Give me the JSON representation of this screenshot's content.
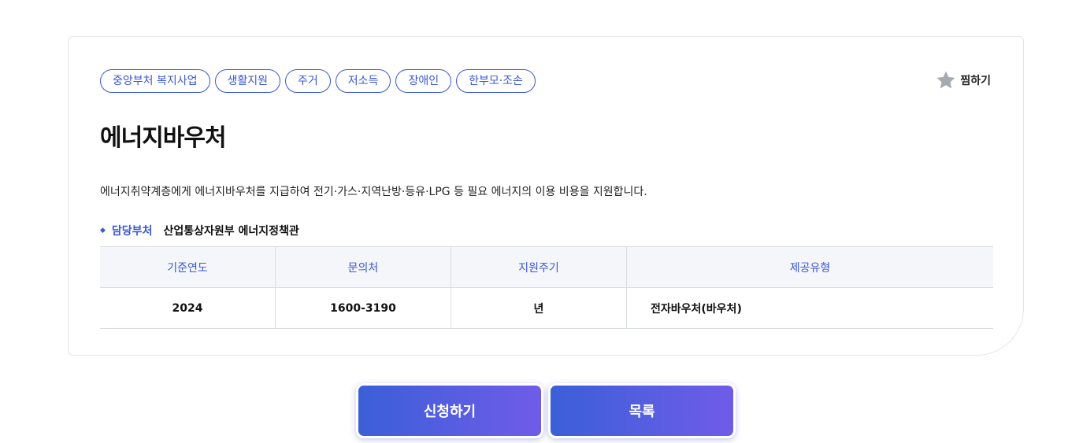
{
  "tags": [
    "중앙부처 복지사업",
    "생활지원",
    "주거",
    "저소득",
    "장애인",
    "한부모·조손"
  ],
  "favorite": {
    "label": "찜하기",
    "icon": "star-icon"
  },
  "title": "에너지바우처",
  "description": "에너지취약계층에게 에너지바우처를 지급하여 전기·가스·지역난방·등유·LPG 등 필요 에너지의 이용 비용을 지원합니다.",
  "department": {
    "label": "담당부처",
    "value": "산업통상자원부 에너지정책관"
  },
  "table": {
    "headers": [
      "기준연도",
      "문의처",
      "지원주기",
      "제공유형"
    ],
    "row": [
      "2024",
      "1600-3190",
      "년",
      "전자바우처(바우처)"
    ]
  },
  "buttons": {
    "apply": "신청하기",
    "list": "목록"
  },
  "colors": {
    "accent": "#3b57d4",
    "button_gradient_start": "#3b5fd8",
    "button_gradient_end": "#6f5ce8"
  }
}
